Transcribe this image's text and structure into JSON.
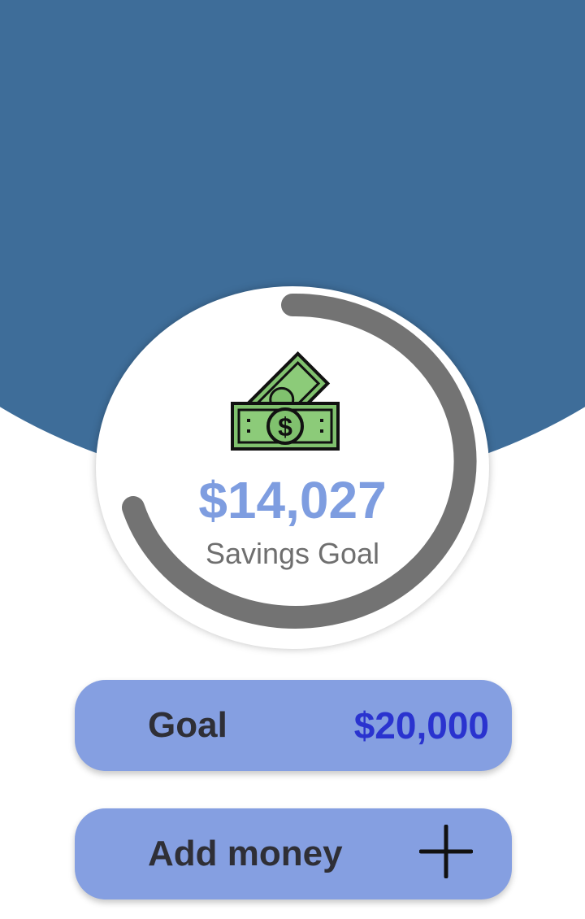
{
  "colors": {
    "header_background": "#3E6D99",
    "accent": "#7E9DE0",
    "button_background": "#859FE1",
    "goal_value": "#2A33CF",
    "label_text": "#2F2F36",
    "progress_arc": "#737373"
  },
  "savings": {
    "amount": "$14,027",
    "label": "Savings Goal",
    "icon": "money-bills-icon",
    "progress_fraction": 0.7014
  },
  "goal": {
    "label": "Goal",
    "value": "$20,000"
  },
  "add_money": {
    "label": "Add money",
    "icon": "plus-icon"
  }
}
